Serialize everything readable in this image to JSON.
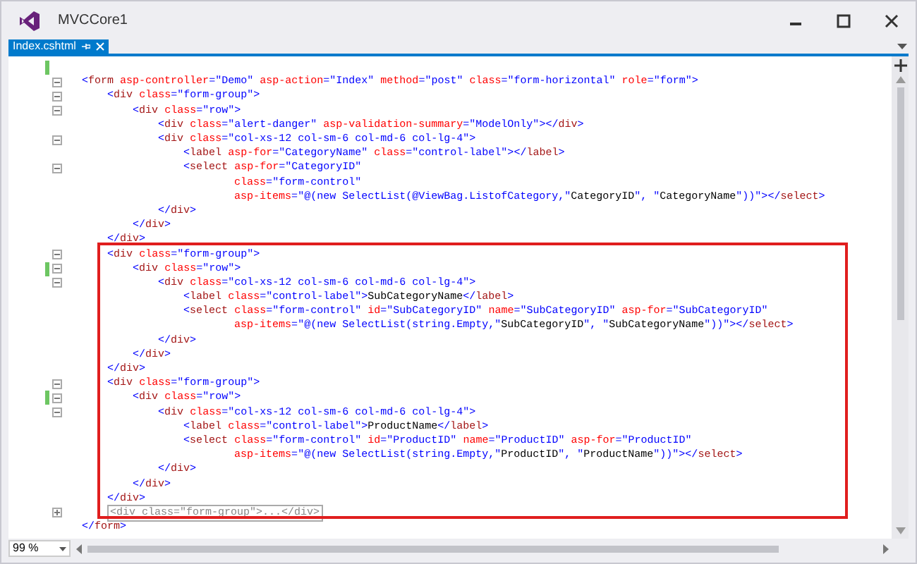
{
  "window": {
    "title": "MVCCore1"
  },
  "tabs": [
    {
      "label": "Index.cshtml",
      "selected": true
    }
  ],
  "editor": {
    "lines": [
      {
        "changed": true
      },
      {
        "text": "<form asp-controller=\"Demo\" asp-action=\"Index\" method=\"post\" class=\"form-horizontal\" role=\"form\">",
        "collapsed": false
      },
      {
        "text": "    <div class=\"form-group\">",
        "collapsed": false
      },
      {
        "text": "        <div class=\"row\">",
        "collapsed": false
      },
      {
        "text": "            <div class=\"alert-danger\" asp-validation-summary=\"ModelOnly\"></div>"
      },
      {
        "text": "            <div class=\"col-xs-12 col-sm-6 col-md-6 col-lg-4\">",
        "collapsed": false
      },
      {
        "text": "                <label asp-for=\"CategoryName\" class=\"control-label\"></label>"
      },
      {
        "text": "                <select asp-for=\"CategoryID\"",
        "collapsed": false
      },
      {
        "text": "                        class=\"form-control\""
      },
      {
        "text": "                        asp-items=\"@(new SelectList(@ViewBag.ListofCategory,\"CategoryID\", \"CategoryName\"))\"></select>"
      },
      {
        "text": "            </div>"
      },
      {
        "text": "        </div>"
      },
      {
        "text": "    </div>"
      },
      {
        "text": "    <div class=\"form-group\">",
        "collapsed": false
      },
      {
        "text": "        <div class=\"row\">",
        "collapsed": false,
        "changed": true
      },
      {
        "text": "            <div class=\"col-xs-12 col-sm-6 col-md-6 col-lg-4\">",
        "collapsed": false
      },
      {
        "text": "                <label class=\"control-label\">SubCategoryName</label>"
      },
      {
        "text": "                <select class=\"form-control\" id=\"SubCategoryID\" name=\"SubCategoryID\" asp-for=\"SubCategoryID\""
      },
      {
        "text": "                        asp-items=\"@(new SelectList(string.Empty,\"SubCategoryID\", \"SubCategoryName\"))\"></select>"
      },
      {
        "text": "            </div>"
      },
      {
        "text": "        </div>"
      },
      {
        "text": "    </div>"
      },
      {
        "text": "    <div class=\"form-group\">",
        "collapsed": false
      },
      {
        "text": "        <div class=\"row\">",
        "collapsed": false,
        "changed": true
      },
      {
        "text": "            <div class=\"col-xs-12 col-sm-6 col-md-6 col-lg-4\">",
        "collapsed": false
      },
      {
        "text": "                <label class=\"control-label\">ProductName</label>"
      },
      {
        "text": "                <select class=\"form-control\" id=\"ProductID\" name=\"ProductID\" asp-for=\"ProductID\""
      },
      {
        "text": "                        asp-items=\"@(new SelectList(string.Empty,\"ProductID\", \"ProductName\"))\"></select>"
      },
      {
        "text": "            </div>"
      },
      {
        "text": "        </div>"
      },
      {
        "text": "    </div>"
      },
      {
        "text": "    <div class=\"form-group\">...</div>",
        "collapsed": true
      },
      {
        "text": "</form>"
      }
    ]
  },
  "status_bar": {
    "zoom": "99 %"
  }
}
